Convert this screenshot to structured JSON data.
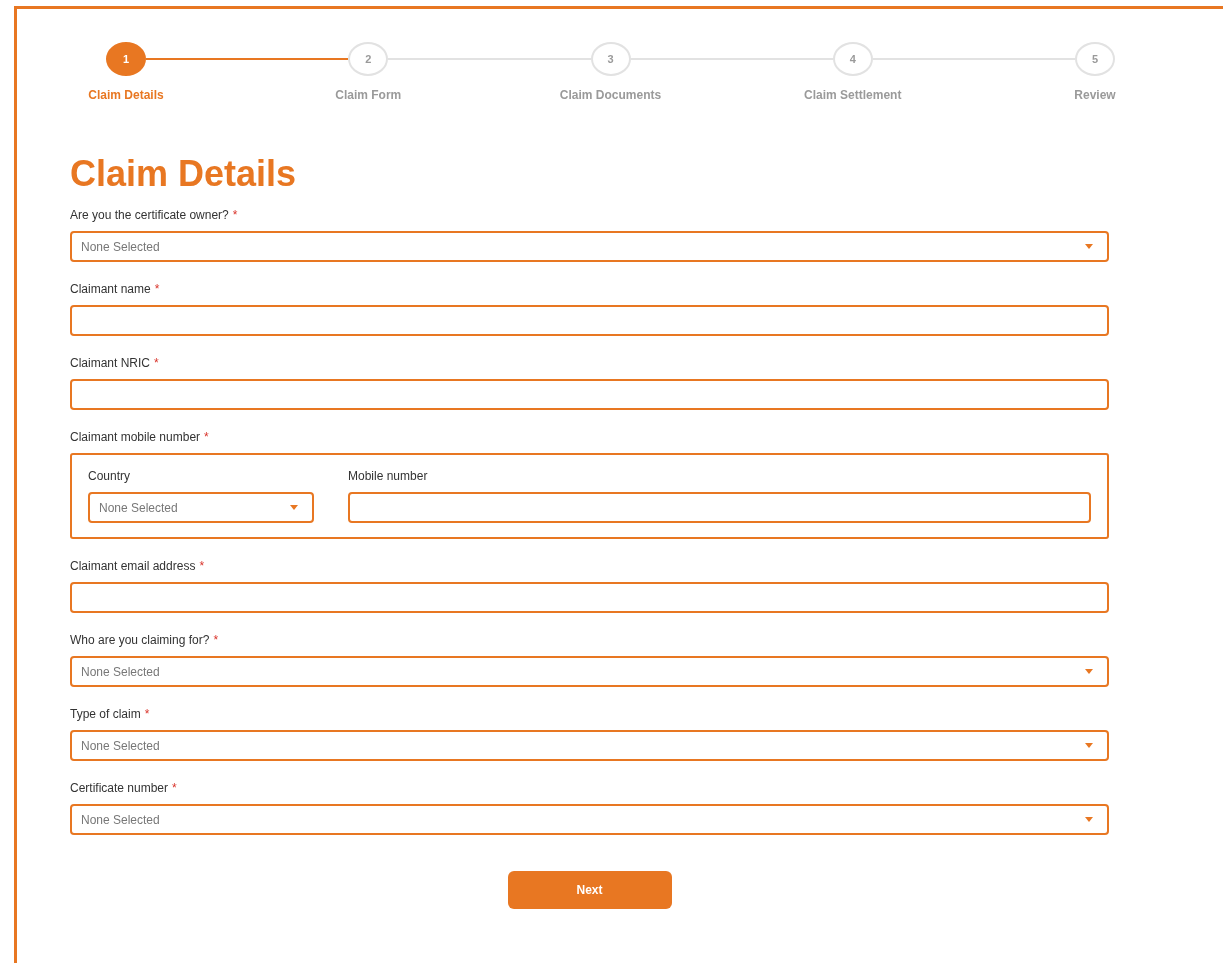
{
  "stepper": [
    {
      "number": "1",
      "label": "Claim Details",
      "selected": true
    },
    {
      "number": "2",
      "label": "Claim Form",
      "selected": false
    },
    {
      "number": "3",
      "label": "Claim Documents",
      "selected": false
    },
    {
      "number": "4",
      "label": "Claim Settlement",
      "selected": false
    },
    {
      "number": "5",
      "label": "Review",
      "selected": false
    }
  ],
  "title": "Claim Details",
  "fields": [
    {
      "kind": "select",
      "label": "Are you the certificate owner?",
      "required_mark": "*",
      "placeholder": "None Selected"
    },
    {
      "kind": "text",
      "label": "Claimant name",
      "required_mark": "*"
    },
    {
      "kind": "text",
      "label": "Claimant NRIC",
      "required_mark": "*"
    },
    {
      "kind": "phone",
      "label": "Claimant mobile number",
      "required_mark": "*",
      "country": {
        "label": "Country",
        "placeholder": "None Selected"
      },
      "mobile": {
        "label": "Mobile number"
      }
    },
    {
      "kind": "text",
      "label": "Claimant email address",
      "required_mark": "*"
    },
    {
      "kind": "select",
      "label": "Who are you claiming for?",
      "required_mark": "*",
      "placeholder": "None Selected"
    },
    {
      "kind": "select",
      "label": "Type of claim",
      "required_mark": "*",
      "placeholder": "None Selected"
    },
    {
      "kind": "select",
      "label": "Certificate number",
      "required_mark": "*",
      "placeholder": "None Selected"
    }
  ],
  "button": "Next"
}
